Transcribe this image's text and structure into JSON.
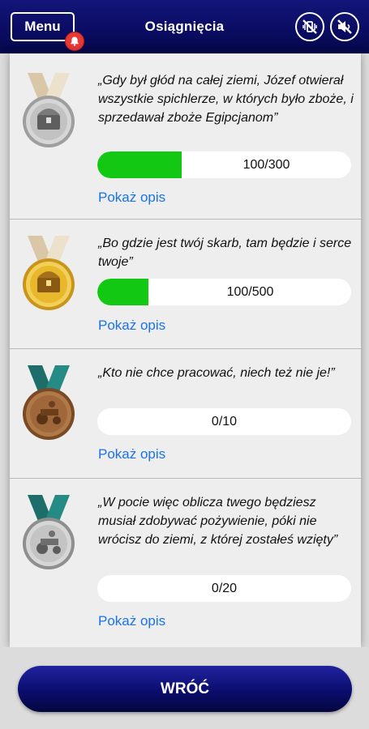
{
  "header": {
    "menu_label": "Menu",
    "title": "Osiągnięcia",
    "icons": {
      "notification": "bell-icon",
      "vibration": "vibration-off-icon",
      "sound": "sound-off-icon"
    }
  },
  "achievements": [
    {
      "quote": "„Gdy był głód na całej ziemi, Józef otwierał wszystkie spichlerze, w których było zboże, i sprzedawał zboże Egipcjanom”",
      "progress_text": "100/300",
      "progress_fraction": 0.333,
      "show_label": "Pokaż opis",
      "medal": "silver-treasure-chest-medal-icon"
    },
    {
      "quote": "„Bo gdzie jest twój skarb, tam będzie i serce twoje”",
      "progress_text": "100/500",
      "progress_fraction": 0.2,
      "show_label": "Pokaż opis",
      "medal": "gold-treasure-chest-medal-icon"
    },
    {
      "quote": "„Kto nie chce pracować, niech też nie je!”",
      "progress_text": "0/10",
      "progress_fraction": 0,
      "show_label": "Pokaż opis",
      "medal": "bronze-farmer-medal-icon"
    },
    {
      "quote": "„W pocie więc oblicza twego będziesz musiał zdobywać pożywienie, póki nie wrócisz do ziemi, z której zostałeś wzięty”",
      "progress_text": "0/20",
      "progress_fraction": 0,
      "show_label": "Pokaż opis",
      "medal": "silver-farmer-medal-icon"
    }
  ],
  "footer": {
    "back_label": "WRÓĆ"
  },
  "colors": {
    "header": "#0a0c62",
    "progress": "#12c812",
    "link": "#1a73e8",
    "gold": "#e8b82c",
    "silver": "#bdbdbd",
    "bronze": "#a0673b"
  }
}
